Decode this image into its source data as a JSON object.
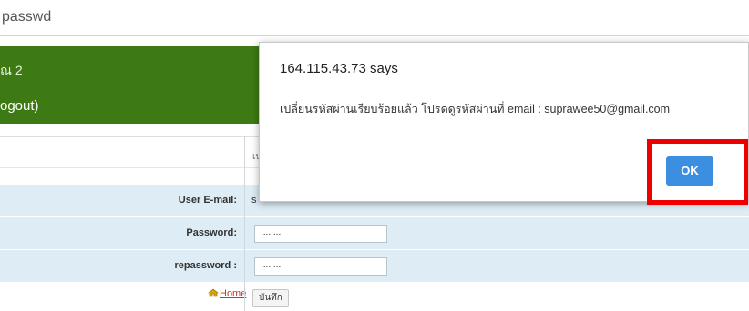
{
  "browser": {
    "address_text": "passwd"
  },
  "banner": {
    "line1": "ณ 2",
    "line2": "ogout)"
  },
  "table": {
    "top_peek": "เป",
    "email": {
      "label": "User E-mail:",
      "value_peek": "s"
    },
    "password": {
      "label": "Password:",
      "value": "........"
    },
    "repassword": {
      "label": "repassword :",
      "value": "........"
    },
    "home_link": "Home",
    "save_button": "บันทึก"
  },
  "dialog": {
    "title": "164.115.43.73 says",
    "message": "เปลี่ยนรหัสผ่านเรียบร้อยแล้ว โปรดดูรหัสผ่านที่ email : suprawee50@gmail.com",
    "ok_label": "OK"
  },
  "colors": {
    "banner": "#3d7a14",
    "row_highlight": "#deedf5",
    "ok_button": "#3c8fe0",
    "annotation": "#ee0000"
  }
}
